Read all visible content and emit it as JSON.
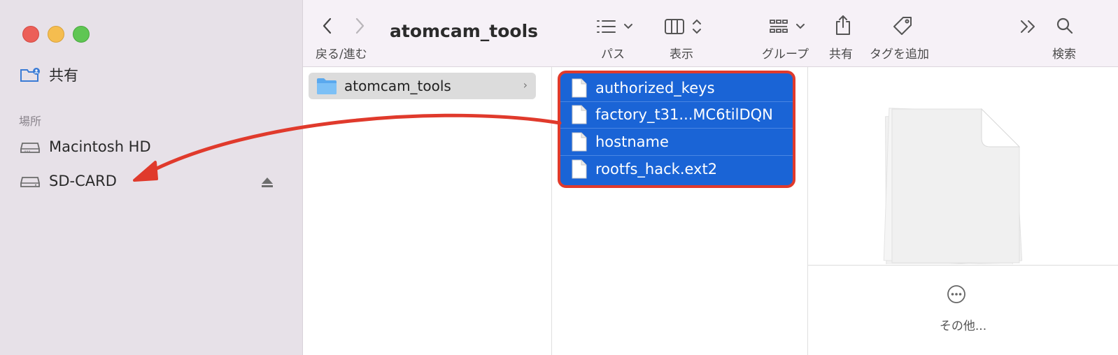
{
  "window": {
    "title": "atomcam_tools"
  },
  "toolbar": {
    "back_forward_label": "戻る/進む",
    "path_label": "パス",
    "view_label": "表示",
    "group_label": "グループ",
    "share_label": "共有",
    "tag_label": "タグを追加",
    "search_label": "検索"
  },
  "sidebar": {
    "shared_label": "共有",
    "locations_header": "場所",
    "items": [
      {
        "label": "Macintosh HD"
      },
      {
        "label": "SD-CARD"
      }
    ]
  },
  "column1": {
    "folder_label": "atomcam_tools"
  },
  "column2": {
    "files": [
      {
        "label": "authorized_keys"
      },
      {
        "label": "factory_t31...MC6tilDQN"
      },
      {
        "label": "hostname"
      },
      {
        "label": "rootfs_hack.ext2"
      }
    ]
  },
  "preview": {
    "more_label": "その他..."
  },
  "colors": {
    "selection": "#1a64d6",
    "annotation": "#e03a2c",
    "sidebar": "#e7e1e8"
  }
}
